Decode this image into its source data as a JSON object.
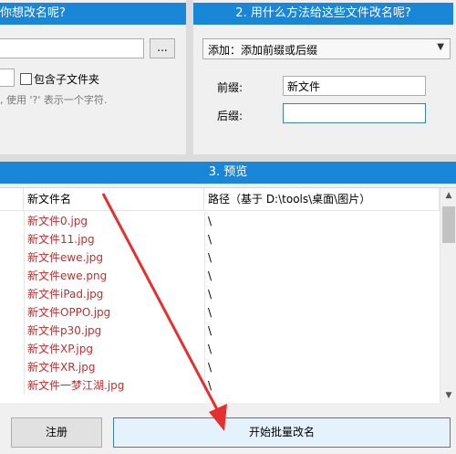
{
  "step1": {
    "header": "你想改名呢?"
  },
  "step2": {
    "header": "2. 用什么方法给这些文件改名呢?"
  },
  "step3": {
    "header": "3. 预览"
  },
  "options": {
    "browse_label": "...",
    "include_subfolders_label": "包含子文件夹",
    "include_subfolders_checked": false,
    "hint": ", 使用 '?' 表示一个字符."
  },
  "method": {
    "selected": "添加：添加前缀或后缀",
    "prefix_label": "前缀:",
    "prefix_value": "新文件",
    "suffix_label": "后缀:",
    "suffix_value": ""
  },
  "preview": {
    "col_name": "新文件名",
    "col_path": "路径（基于 D:\\tools\\桌面\\图片）",
    "rows": [
      {
        "name": "新文件0.jpg",
        "path": "\\"
      },
      {
        "name": "新文件11.jpg",
        "path": "\\"
      },
      {
        "name": "新文件ewe.jpg",
        "path": "\\"
      },
      {
        "name": "新文件ewe.png",
        "path": "\\"
      },
      {
        "name": "新文件iPad.jpg",
        "path": "\\"
      },
      {
        "name": "新文件OPPO.jpg",
        "path": "\\"
      },
      {
        "name": "新文件p30.jpg",
        "path": "\\"
      },
      {
        "name": "新文件XP.jpg",
        "path": "\\"
      },
      {
        "name": "新文件XR.jpg",
        "path": "\\"
      },
      {
        "name": "新文件一梦江湖.jpg",
        "path": "\\"
      }
    ]
  },
  "footer": {
    "register_label": "注册",
    "start_label": "开始批量改名"
  },
  "colors": {
    "header_bg": "#1a86d8",
    "new_name_text": "#cc2a2a",
    "annotation_arrow": "#e53030"
  },
  "icons": {
    "dropdown": "chevron-down-icon",
    "annotation": "arrow-icon"
  }
}
